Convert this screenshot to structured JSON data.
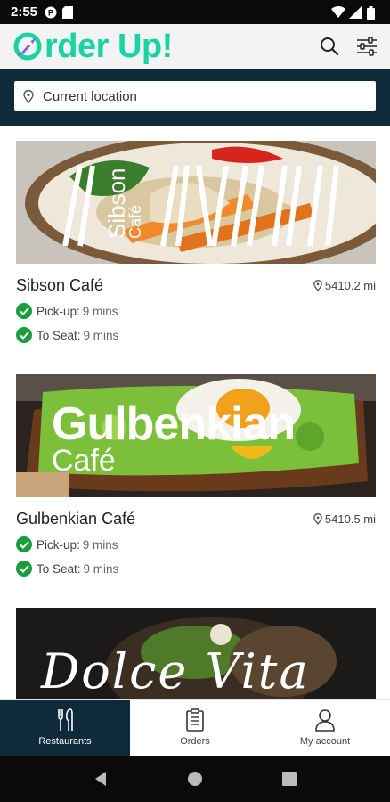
{
  "status_bar": {
    "time": "2:55"
  },
  "app_bar": {
    "logo_text": "rder Up!",
    "brand_color": "#19d3a2"
  },
  "location": {
    "placeholder": "Current location"
  },
  "restaurants": [
    {
      "name": "Sibson Café",
      "distance": "5410.2 mi",
      "image_title": "Sibson",
      "image_subtitle": "Café",
      "pickup_label": "Pick-up:",
      "pickup_value": "9 mins",
      "seat_label": "To Seat:",
      "seat_value": "9 mins"
    },
    {
      "name": "Gulbenkian Café",
      "distance": "5410.5 mi",
      "image_title": "Gulbenkian",
      "image_subtitle": "Café",
      "pickup_label": "Pick-up:",
      "pickup_value": "9 mins",
      "seat_label": "To Seat:",
      "seat_value": "9 mins"
    },
    {
      "image_title": "Dolce Vita"
    }
  ],
  "bottom_nav": [
    {
      "label": "Restaurants",
      "icon": "cutlery-icon",
      "active": true
    },
    {
      "label": "Orders",
      "icon": "clipboard-icon"
    },
    {
      "label": "My account",
      "icon": "user-icon"
    }
  ],
  "colors": {
    "header_dark": "#0e2a3b",
    "check_green": "#1a9d3c"
  }
}
